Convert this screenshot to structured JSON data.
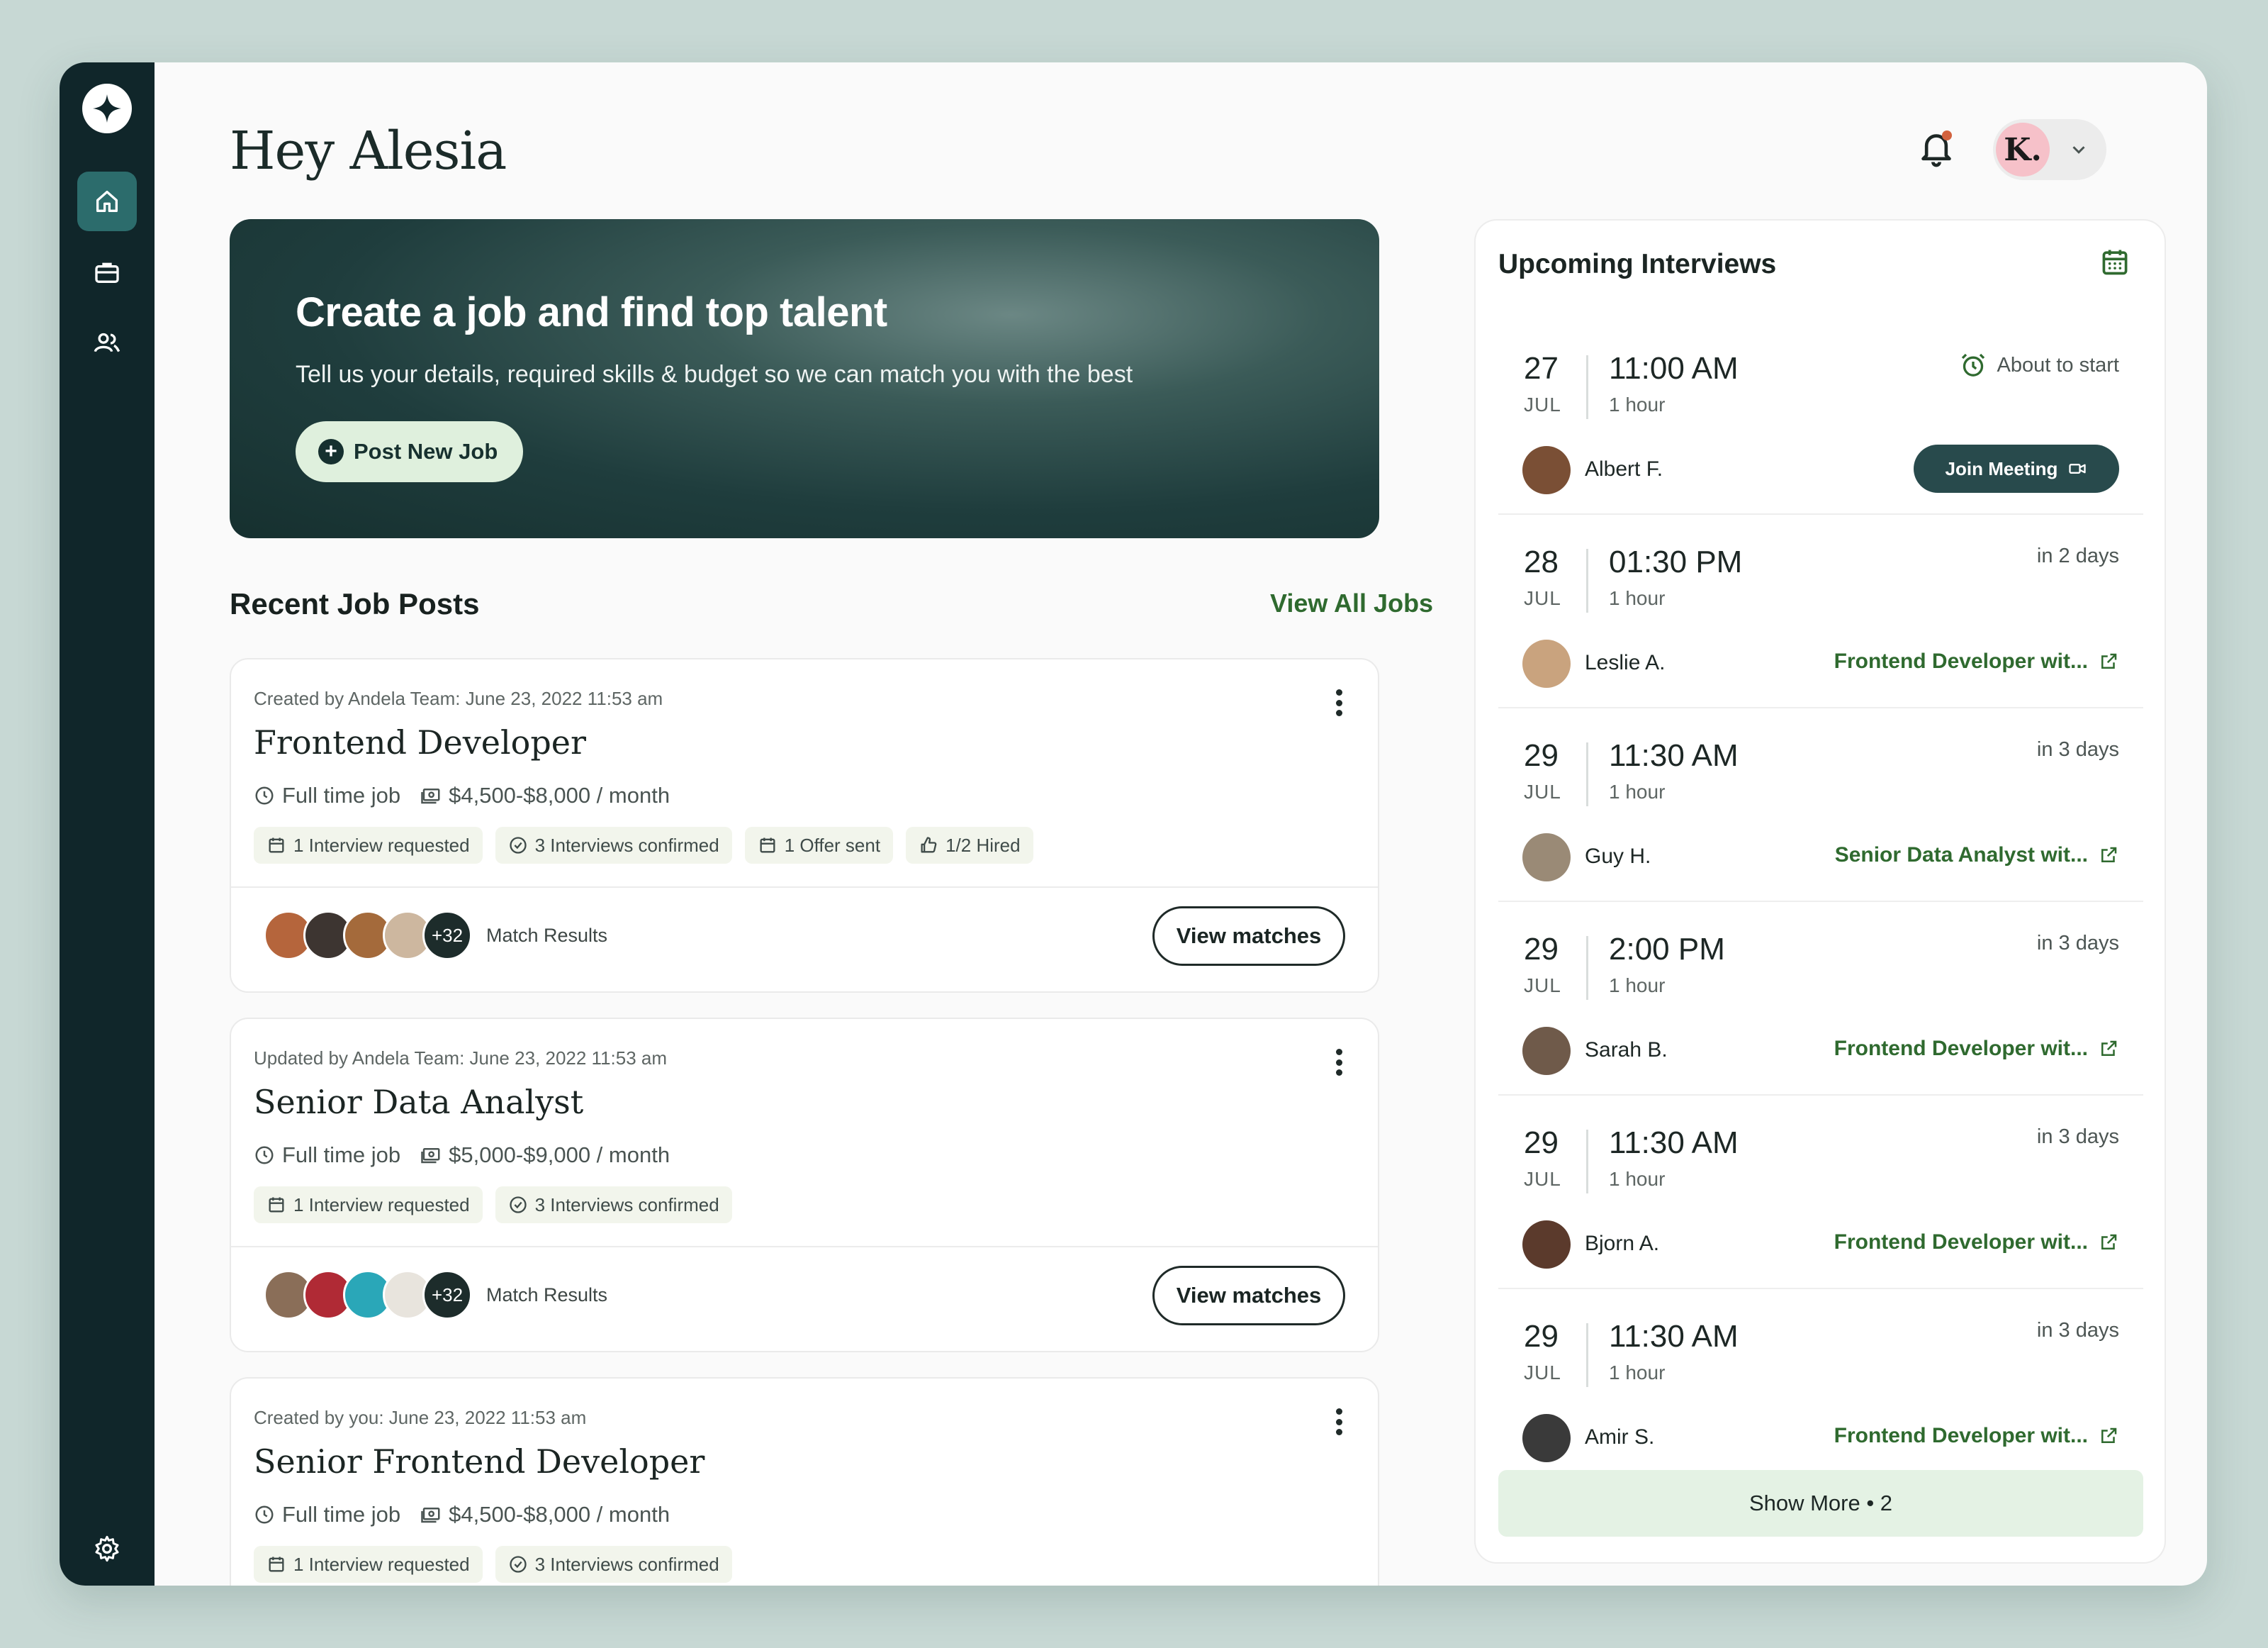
{
  "greeting": "Hey Alesia",
  "user": {
    "initials": "K."
  },
  "colors": {
    "accent": "#2f6a2f",
    "sidebar": "#10262a",
    "active_nav": "#2c6c6c"
  },
  "sidebar": {
    "items": [
      {
        "icon": "home-icon",
        "active": true
      },
      {
        "icon": "briefcase-icon",
        "active": false
      },
      {
        "icon": "users-icon",
        "active": false
      },
      {
        "icon": "gear-icon",
        "active": false
      }
    ]
  },
  "hero": {
    "title": "Create a job and find top talent",
    "subtitle": "Tell us your details, required skills & budget so we can match you with the best",
    "button": "Post New Job"
  },
  "recent": {
    "title": "Recent Job Posts",
    "view_all": "View All Jobs",
    "jobs": [
      {
        "meta": "Created by Andela Team: June 23, 2022 11:53 am",
        "title": "Frontend Developer",
        "type": "Full time job",
        "salary": "$4,500-$8,000 / month",
        "tags": [
          "1 Interview requested",
          "3 Interviews confirmed",
          "1 Offer sent",
          "1/2 Hired"
        ],
        "more_count": "+32",
        "match_label": "Match Results",
        "button": "View matches"
      },
      {
        "meta": "Updated by Andela Team: June 23, 2022 11:53 am",
        "title": "Senior Data Analyst",
        "type": "Full time job",
        "salary": "$5,000-$9,000 / month",
        "tags": [
          "1 Interview requested",
          "3 Interviews confirmed"
        ],
        "more_count": "+32",
        "match_label": "Match Results",
        "button": "View matches"
      },
      {
        "meta": "Created by you: June 23, 2022 11:53 am",
        "title": "Senior Frontend Developer",
        "type": "Full time job",
        "salary": "$4,500-$8,000 / month",
        "tags": [
          "1 Interview requested",
          "3 Interviews confirmed"
        ]
      }
    ]
  },
  "interviews": {
    "title": "Upcoming Interviews",
    "items": [
      {
        "day": "27",
        "month": "JUL",
        "time": "11:00 AM",
        "duration": "1 hour",
        "status": "About to start",
        "name": "Albert F.",
        "action": "Join Meeting"
      },
      {
        "day": "28",
        "month": "JUL",
        "time": "01:30 PM",
        "duration": "1 hour",
        "status": "in 2 days",
        "name": "Leslie A.",
        "job": "Frontend Developer wit..."
      },
      {
        "day": "29",
        "month": "JUL",
        "time": "11:30 AM",
        "duration": "1 hour",
        "status": "in 3 days",
        "name": "Guy H.",
        "job": "Senior Data Analyst wit..."
      },
      {
        "day": "29",
        "month": "JUL",
        "time": "2:00 PM",
        "duration": "1 hour",
        "status": "in 3 days",
        "name": "Sarah B.",
        "job": "Frontend Developer wit..."
      },
      {
        "day": "29",
        "month": "JUL",
        "time": "11:30 AM",
        "duration": "1 hour",
        "status": "in 3 days",
        "name": "Bjorn A.",
        "job": "Frontend Developer wit..."
      },
      {
        "day": "29",
        "month": "JUL",
        "time": "11:30 AM",
        "duration": "1 hour",
        "status": "in 3 days",
        "name": "Amir S.",
        "job": "Frontend Developer wit..."
      }
    ],
    "show_more": "Show More • 2"
  }
}
